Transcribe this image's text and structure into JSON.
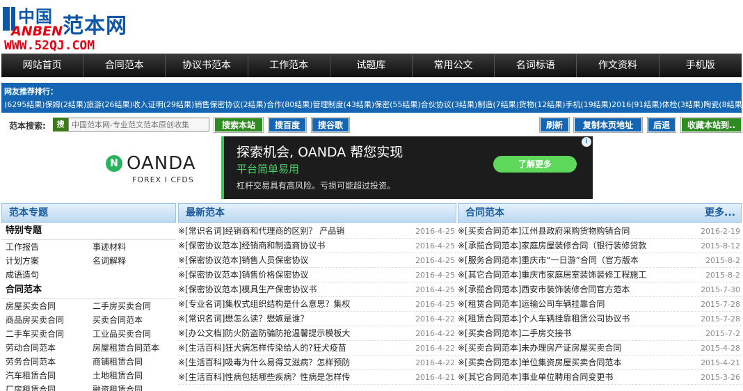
{
  "logo": {
    "cn_small": "中国",
    "cn_big": "范本网",
    "en_prefix": "ANBEN",
    "url": "WWW.52QJ.COM"
  },
  "nav": [
    "网站首页",
    "合同范本",
    "协议书范本",
    "工作范本",
    "试题库",
    "常用公文",
    "名词标语",
    "作文资料",
    "手机版"
  ],
  "hot": {
    "label": "网友推荐排行：",
    "items": [
      "(6295结果)保姆",
      "(2结果)旅游",
      "(26结果)收入证明",
      "(29结果)销售保密协议",
      "(2结果)合作",
      "(80结果)管理制度",
      "(43结果)保密",
      "(55结果)合伙协议",
      "(3结果)制造",
      "(7结果)货物",
      "(12结果)手机",
      "(19结果)2016",
      "(91结果)体检",
      "(3结果)陶瓷",
      "(8结果)流程",
      "(18结果)四月",
      "(2结果)医院",
      "(51结果)声明函",
      "(2结果)新员工",
      "(4结果)"
    ]
  },
  "search": {
    "label": "范本搜索:",
    "icon_text": "搜",
    "placeholder": "中国范本网-专业范文范本原创收集",
    "btn_site": "搜索本站",
    "btn_baidu": "搜百度",
    "btn_google": "搜谷歌",
    "btn_refresh": "刷新",
    "btn_copy": "复制本页地址",
    "btn_back": "后退",
    "btn_fav": "收藏本站到.."
  },
  "ad": {
    "brand": "OANDA",
    "brand_sub": "FOREX I CFDS",
    "headline": "探索机会, OANDA 帮您实现",
    "subline": "平台简单易用",
    "disclaimer": "杠杆交易具有高风险。亏损可能超过投资。",
    "cta": "了解更多"
  },
  "left": {
    "title": "范本专题",
    "sections": [
      {
        "name": "特别专题",
        "items": [
          "工作报告",
          "事迹材料",
          "计划方案",
          "名词解释",
          "成语造句"
        ]
      },
      {
        "name": "合同范本",
        "items": [
          "房屋买卖合同",
          "二手房买卖合同",
          "商品房买卖合同",
          "买卖合同范本",
          "二手车买卖合同",
          "工业品买卖合同",
          "劳动合同范本",
          "房屋租赁合同范本",
          "劳务合同范本",
          "商铺租赁合同",
          "汽车租赁合同",
          "土地租赁合同",
          "厂房租赁合同",
          "融资租赁合同"
        ]
      }
    ]
  },
  "mid": {
    "title": "最新范本",
    "rows": [
      {
        "t": "※[常识名词]经销商和代理商的区别？ 产品销",
        "d": "2016-4-25"
      },
      {
        "t": "※[保密协议范本]经销商和制造商协议书",
        "d": "2016-4-25"
      },
      {
        "t": "※[保密协议范本]销售人员保密协议",
        "d": "2016-4-25"
      },
      {
        "t": "※[保密协议范本]销售价格保密协议",
        "d": "2016-4-25"
      },
      {
        "t": "※[保密协议范本]模具生产保密协议书",
        "d": "2016-4-25"
      },
      {
        "t": "※[专业名词]集权式组织结构是什么意思？集权",
        "d": "2016-4-25"
      },
      {
        "t": "※[常识名词]懋怎么读？懋嫉是谁？",
        "d": "2016-4-22"
      },
      {
        "t": "※[办公文档]防火防盗防骗防抢温馨提示模板大",
        "d": "2016-4-22"
      },
      {
        "t": "※[生活百科]狂犬病怎样传染给人的?狂犬疫苗",
        "d": "2016-4-22"
      },
      {
        "t": "※[生活百科]吸毒为什么易得艾滋病？怎样预防",
        "d": "2016-4-22"
      },
      {
        "t": "※[生活百科]性病包括哪些疾病？性病是怎样传",
        "d": "2016-4-21"
      }
    ]
  },
  "right": {
    "title": "合同范本",
    "more": "更多...",
    "rows": [
      {
        "t": "※[买卖合同范本]江州县政府采购货物购销合同",
        "d": "2016-2-19"
      },
      {
        "t": "※[承揽合同范本]家庭房屋装修合同（银行装修贷款",
        "d": "2015-8-12"
      },
      {
        "t": "※[服务合同范本]重庆市“一日游”合同（官方版本",
        "d": "2015-8-2"
      },
      {
        "t": "※[其它合同范本]重庆市家庭居室装饰装修工程施工",
        "d": "2015-8-2"
      },
      {
        "t": "※[承揽合同范本]西安市装饰装修合同官方范本",
        "d": "2015-7-30"
      },
      {
        "t": "※[租赁合同范本]运输公司车辆挂靠合同",
        "d": "2015-7-28"
      },
      {
        "t": "※[租赁合同范本]个人车辆挂靠租赁公司协议书",
        "d": "2015-7-28"
      },
      {
        "t": "※[买卖合同范本]二手房交接书",
        "d": "2015-7-2"
      },
      {
        "t": "※[买卖合同范本]未办理房产证房屋买卖合同",
        "d": "2015-4-28"
      },
      {
        "t": "※[买卖合同范本]单位集资房屋买卖合同范本",
        "d": "2015-4-21"
      },
      {
        "t": "※[其它合同范本]事业单位聘用合同变更书",
        "d": "2015-3-26"
      }
    ]
  }
}
